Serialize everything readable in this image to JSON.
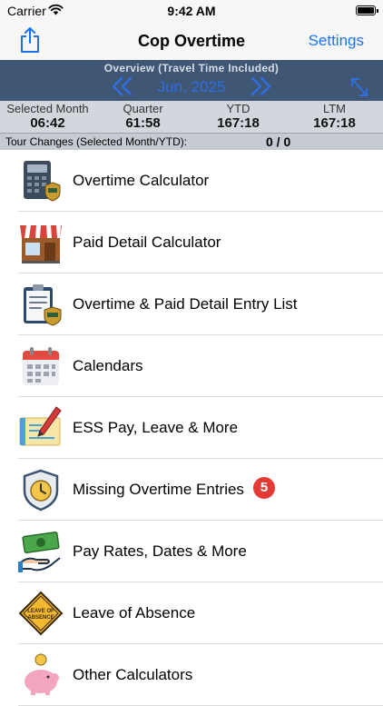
{
  "status_bar": {
    "carrier": "Carrier",
    "time": "9:42 AM"
  },
  "nav": {
    "title": "Cop Overtime",
    "settings_label": "Settings"
  },
  "overview": {
    "title": "Overview (Travel Time Included)",
    "month": "Jun, 2025",
    "stats": [
      {
        "label": "Selected Month",
        "value": "06:42"
      },
      {
        "label": "Quarter",
        "value": "61:58"
      },
      {
        "label": "YTD",
        "value": "167:18"
      },
      {
        "label": "LTM",
        "value": "167:18"
      }
    ]
  },
  "tour_changes": {
    "label": "Tour Changes (Selected Month/YTD):",
    "value": "0 / 0"
  },
  "menu": {
    "items": [
      {
        "label": "Overtime Calculator",
        "icon": "calculator-icon"
      },
      {
        "label": "Paid Detail Calculator",
        "icon": "storefront-icon"
      },
      {
        "label": "Overtime & Paid Detail Entry List",
        "icon": "clipboard-icon"
      },
      {
        "label": "Calendars",
        "icon": "calendar-icon"
      },
      {
        "label": "ESS Pay, Leave & More",
        "icon": "check-pen-icon"
      },
      {
        "label": "Missing Overtime Entries",
        "icon": "clock-badge-icon",
        "badge": "5"
      },
      {
        "label": "Pay Rates, Dates & More",
        "icon": "money-hand-icon"
      },
      {
        "label": "Leave of Absence",
        "icon": "leave-sign-icon",
        "sign_text": [
          "LEAVE OF",
          "ABSENCE"
        ]
      },
      {
        "label": "Other Calculators",
        "icon": "piggy-bank-icon"
      }
    ]
  },
  "colors": {
    "accent": "#1a73e8",
    "overview_bg": "#3f5674",
    "badge": "#e53935"
  }
}
